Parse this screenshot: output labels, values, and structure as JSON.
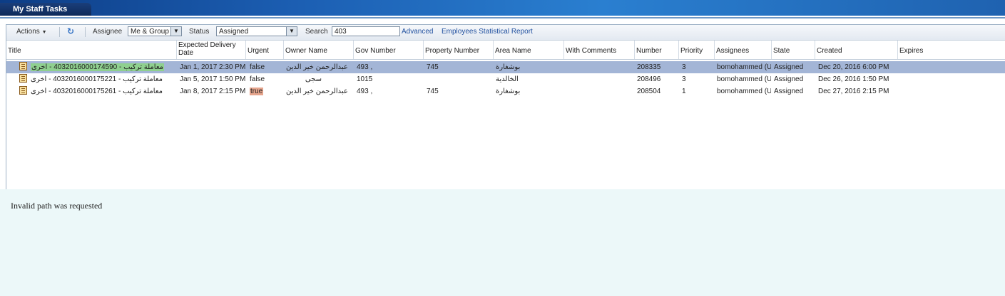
{
  "window": {
    "tab_title": "My Staff Tasks"
  },
  "toolbar": {
    "actions_label": "Actions",
    "assignee_label": "Assignee",
    "assignee_value": "Me & Group",
    "status_label": "Status",
    "status_value": "Assigned",
    "search_label": "Search",
    "search_value": "403",
    "advanced_link": "Advanced",
    "report_link": "Employees Statistical Report"
  },
  "table": {
    "headers": {
      "title": "Title",
      "expected_1": "Expected Delivery",
      "expected_2": "Date",
      "urgent": "Urgent",
      "owner": "Owner Name",
      "gov": "Gov Number",
      "property": "Property Number",
      "area": "Area Name",
      "comments": "With Comments",
      "number": "Number",
      "priority": "Priority",
      "assignees": "Assignees",
      "state": "State",
      "created": "Created",
      "expires": "Expires"
    },
    "rows": [
      {
        "title": "معاملة تركيب - 4032016000174590 - أخرى",
        "expected": "Jan 1, 2017 2:30 PM",
        "urgent": "false",
        "owner": "عبدالرحمن خير الدين",
        "gov": "493 ,",
        "property": "745",
        "area": "بوشغارة",
        "comments": "",
        "number": "208335",
        "priority": "3",
        "assignees": "bomohammed (U",
        "state": "Assigned",
        "created": "Dec 20, 2016 6:00 PM",
        "expires": ""
      },
      {
        "title": "معاملة تركيب - 4032016000175221 - أخرى",
        "expected": "Jan 5, 2017 1:50 PM",
        "urgent": "false",
        "owner": "سجى",
        "gov": "1015",
        "property": "",
        "area": "الخالدية",
        "comments": "",
        "number": "208496",
        "priority": "3",
        "assignees": "bomohammed (U",
        "state": "Assigned",
        "created": "Dec 26, 2016 1:50 PM",
        "expires": ""
      },
      {
        "title": "معاملة تركيب - 4032016000175261 - أخرى",
        "expected": "Jan 8, 2017 2:15 PM",
        "urgent": "true",
        "owner": "عبدالرحمن خير الدين",
        "gov": "493 ,",
        "property": "745",
        "area": "بوشغارة",
        "comments": "",
        "number": "208504",
        "priority": "1",
        "assignees": "bomohammed (U",
        "state": "Assigned",
        "created": "Dec 27, 2016 2:15 PM",
        "expires": ""
      }
    ]
  },
  "detail": {
    "message": "Invalid path was requested"
  },
  "colors": {
    "header_band": "#1c5fb3",
    "selected_row": "#a3b5d6",
    "title_highlight": "#8fd08f",
    "urgent_highlight": "#e6a58d",
    "detail_background": "#ecf8f9",
    "link": "#1f4f9e"
  }
}
